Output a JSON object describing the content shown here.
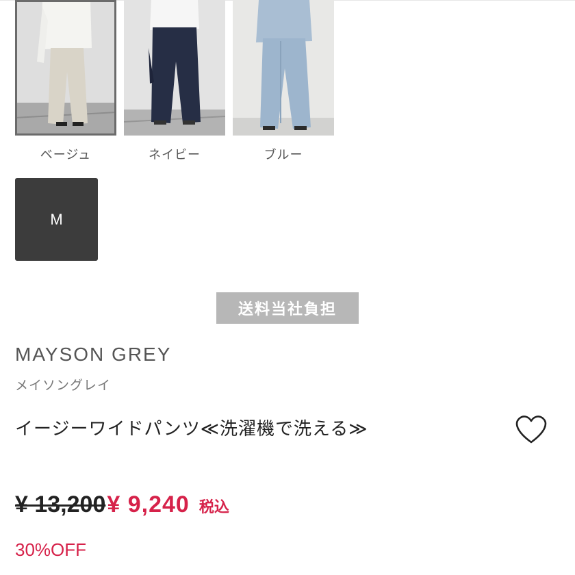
{
  "colors": {
    "accent": "#d6224a",
    "size_selected_bg": "#3c3c3c",
    "badge_bg": "#b7b7b7"
  },
  "swatches": [
    {
      "label": "ベージュ",
      "selected": true
    },
    {
      "label": "ネイビー",
      "selected": false
    },
    {
      "label": "ブルー",
      "selected": false
    }
  ],
  "sizes": [
    {
      "label": "M",
      "selected": true
    }
  ],
  "shipping_badge": "送料当社負担",
  "brand": {
    "name": "MAYSON GREY",
    "kana": "メイソングレイ"
  },
  "product": {
    "title": "イージーワイドパンツ≪洗濯機で洗える≫",
    "favorite_icon": "heart-outline-icon"
  },
  "price": {
    "original": "¥ 13,200",
    "sale": "¥ 9,240",
    "tax_label": "税込",
    "discount": "30%OFF"
  }
}
